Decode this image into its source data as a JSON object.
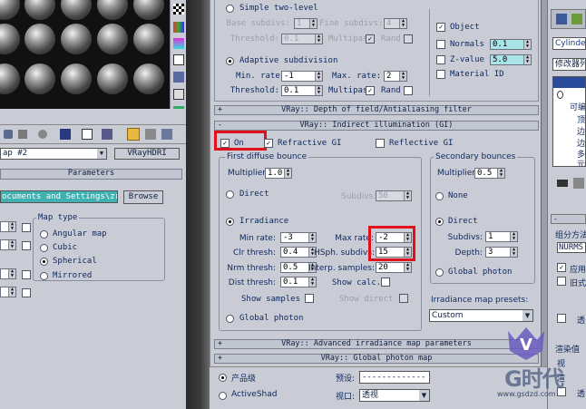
{
  "left_panel": {
    "map_dropdown": "ap #2",
    "map_type_button": "VRayHDRI",
    "params_title": "Parameters",
    "path_value": "ocuments and Settings\\zr\\M",
    "browse": "Browse",
    "map_type_label": "Map type",
    "map_types": [
      "Angular map",
      "Cubic",
      "Spherical",
      "Mirrored"
    ],
    "selected_map_type": "Spherical"
  },
  "dof_rollout": {
    "sign": "+",
    "title": "VRay:: Depth of field/Antialiasing filter"
  },
  "gi_rollout": {
    "sign": "-",
    "title": "VRay:: Indirect illumination (GI)"
  },
  "top_section": {
    "simple_two_level": "Simple two-level",
    "base_subdivs_label": "Base subdivs:",
    "base_subdivs": "1",
    "fine_subdivs_label": "Fine subdivs:",
    "fine_subdivs": "4",
    "threshold_label": "Threshold:",
    "threshold_top": "0.1",
    "multipas": "Multipas",
    "rand": "Rand",
    "adaptive": "Adaptive subdivision",
    "min_rate_label": "Min. rate:",
    "min_rate": "-1",
    "max_rate_label": "Max. rate:",
    "max_rate": "2",
    "threshold_adaptive": "0.1",
    "object": "Object",
    "normals": "Normals",
    "normals_val": "0.1",
    "zvalue": "Z-value",
    "zvalue_val": "5.0",
    "material_id": "Material ID"
  },
  "gi": {
    "on": "On",
    "refractive": "Refractive GI",
    "reflective": "Reflective GI",
    "first_bounce_title": "First diffuse bounce",
    "multiplier_label": "Multiplier:",
    "first_multiplier": "1.0",
    "direct": "Direct",
    "subdivs_label": "Subdivs:",
    "subdivs_disabled": "50",
    "irradiance": "Irradiance",
    "min_rate_label": "Min rate:",
    "min_rate": "-3",
    "max_rate_label": "Max rate:",
    "max_rate": "-2",
    "clr_thresh_label": "Clr thresh:",
    "clr_thresh": "0.4",
    "hsph_label": "HSph. subdivs:",
    "hsph": "15",
    "nrm_thresh_label": "Nrm thresh:",
    "nrm_thresh": "0.5",
    "interp_label": "Interp. samples:",
    "interp": "20",
    "dist_thresh_label": "Dist thresh:",
    "dist_thresh": "0.1",
    "show_calc": "Show calc.",
    "show_samples": "Show samples",
    "show_direct": "Show direct",
    "global_photon": "Global photon",
    "secondary_title": "Secondary bounces",
    "second_multiplier": "0.5",
    "none": "None",
    "second_direct": "Direct",
    "second_subdivs_label": "Subdivs:",
    "second_subdivs": "1",
    "depth_label": "Depth:",
    "depth": "3",
    "second_global_photon": "Global photon",
    "presets_label": "Irradiance map presets:",
    "preset": "Custom"
  },
  "bottom_rollouts": [
    {
      "sign": "+",
      "title": "VRay:: Advanced irradiance map parameters"
    },
    {
      "sign": "+",
      "title": "VRay:: Global photon map"
    }
  ],
  "bottom_bar": {
    "product": "产品级",
    "activeshade": "ActiveShad",
    "preset_label": "预设:",
    "preset_value": "----------------",
    "view_label": "视口:",
    "view_value": "透视"
  },
  "right_panel": {
    "object_name": "Cylinde",
    "modifier_list": "修改器列",
    "tree_labels": [
      "可编",
      "顶",
      "边",
      "边",
      "多",
      "元"
    ],
    "input": "组分方法",
    "input2": "NURMS",
    "apply": "应用",
    "old": "旧式",
    "side_text": [
      "透",
      "透"
    ],
    "render": "渲染值",
    "side_labels": [
      "视",
      "渲"
    ]
  },
  "watermark": {
    "brand": "G时代",
    "url": "www.gsdzd.com"
  },
  "colors": {
    "highlight": "#e0101c",
    "panel": "#c9ccd4",
    "rollout": "#c2c6d0"
  }
}
